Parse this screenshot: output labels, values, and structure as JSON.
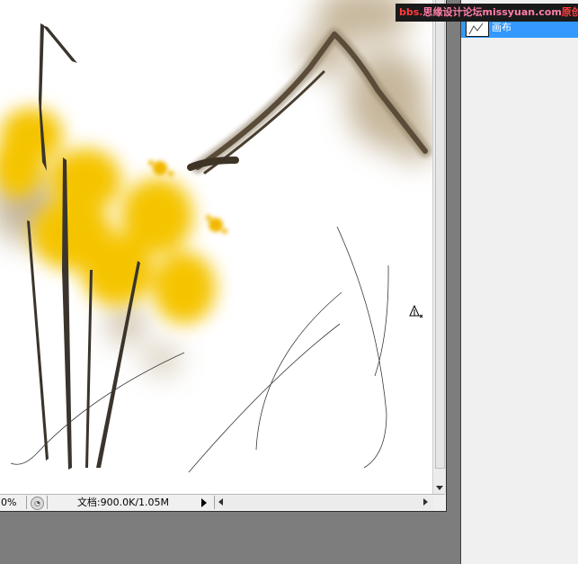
{
  "statusbar": {
    "zoom": "0%",
    "doc_info": "文档:900.0K/1.05M"
  },
  "layers_panel": {
    "layer_name": "画布"
  },
  "watermark": {
    "site": "bbs.",
    "text": "思缘设计论坛",
    "url": "missyuan.com",
    "tag": "原创教程"
  },
  "colors": {
    "ink": "#3a342c",
    "yellow": "#f5c400",
    "wash": "#a99573",
    "selection": "#3399ff"
  }
}
